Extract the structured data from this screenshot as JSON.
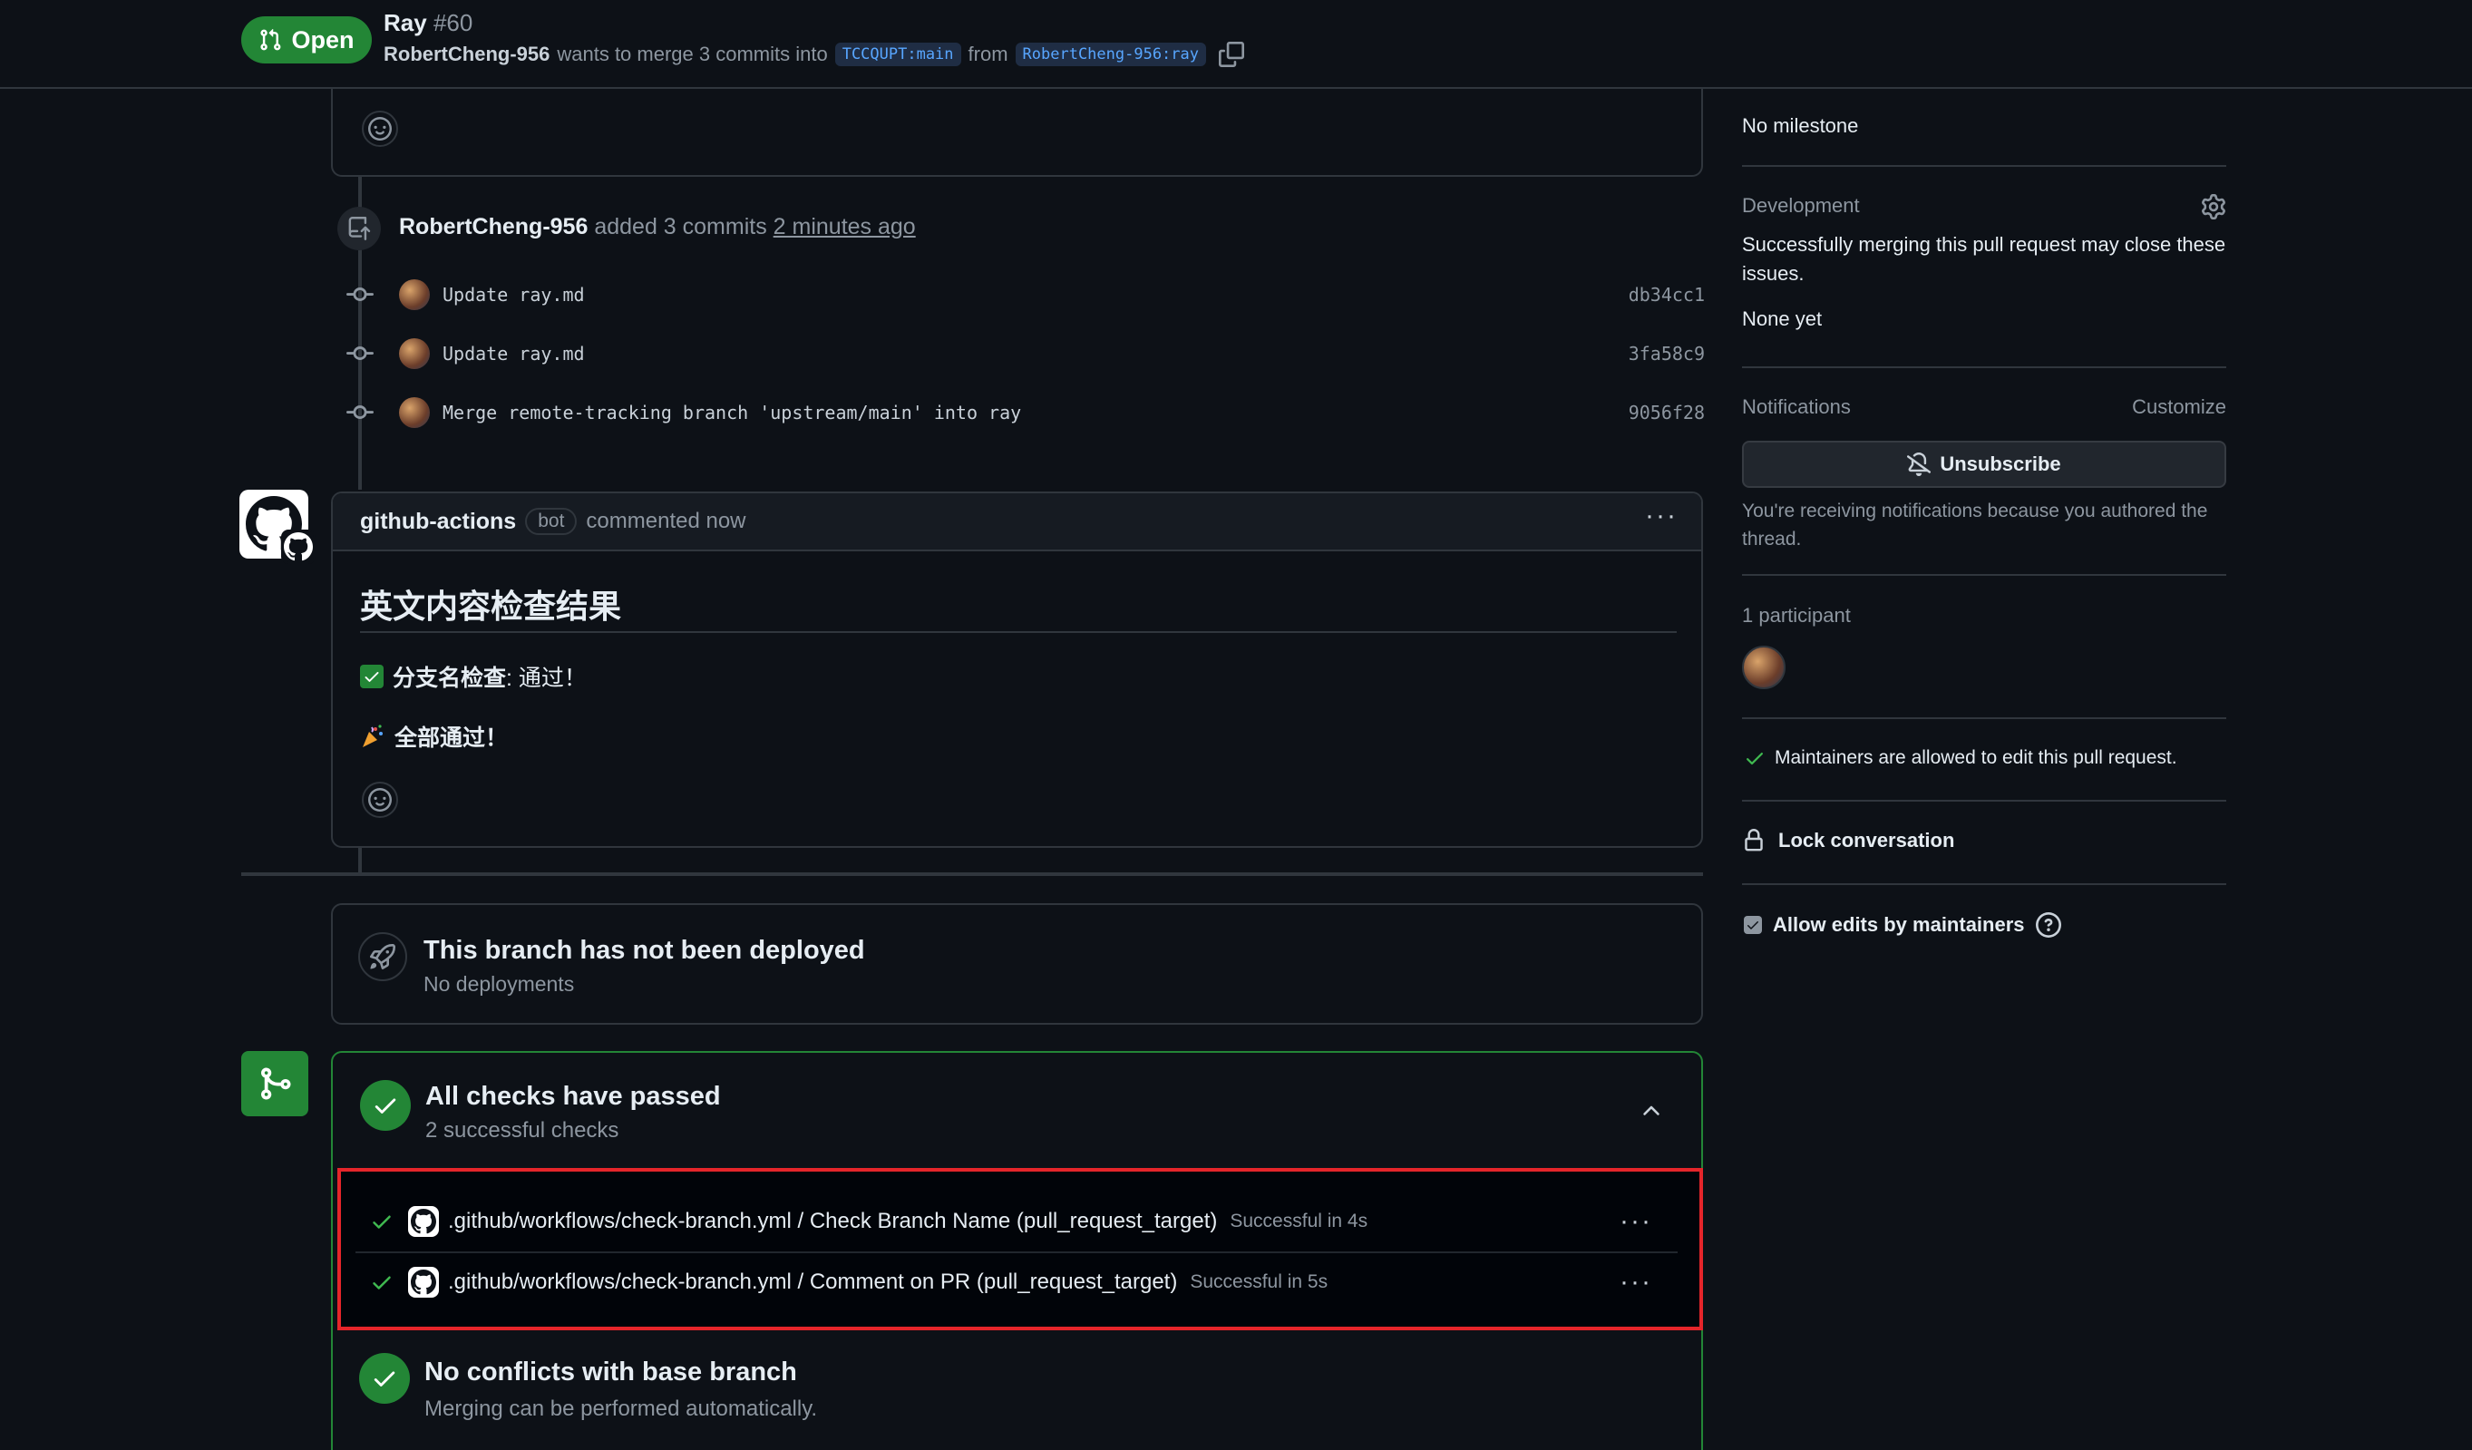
{
  "header": {
    "state": "Open",
    "title": "Ray",
    "number": "#60",
    "author": "RobertCheng-956",
    "merge_text": "wants to merge 3 commits into",
    "base_branch": "TCCQUPT:main",
    "from_text": "from",
    "head_branch": "RobertCheng-956:ray"
  },
  "timeline": {
    "commits_event": {
      "author": "RobertCheng-956",
      "action": "added 3 commits",
      "time": "2 minutes ago",
      "commits": [
        {
          "message": "Update ray.md",
          "sha": "db34cc1"
        },
        {
          "message": "Update ray.md",
          "sha": "3fa58c9"
        },
        {
          "message": "Merge remote-tracking branch 'upstream/main' into ray",
          "sha": "9056f28"
        }
      ]
    },
    "comment": {
      "author": "github-actions",
      "badge": "bot",
      "time": "commented now",
      "heading": "英文内容检查结果",
      "line1_bold": "分支名检查",
      "line1_rest": ": 通过！",
      "line2_bold": "全部通过！"
    },
    "deploy": {
      "title": "This branch has not been deployed",
      "subtitle": "No deployments"
    },
    "checks": {
      "title": "All checks have passed",
      "subtitle": "2 successful checks",
      "items": [
        {
          "name": ".github/workflows/check-branch.yml / Check Branch Name (pull_request_target)",
          "status": "Successful in 4s"
        },
        {
          "name": ".github/workflows/check-branch.yml / Comment on PR (pull_request_target)",
          "status": "Successful in 5s"
        }
      ]
    },
    "conflicts": {
      "title": "No conflicts with base branch",
      "subtitle": "Merging can be performed automatically."
    }
  },
  "sidebar": {
    "milestone_value": "No milestone",
    "development_label": "Development",
    "development_text": "Successfully merging this pull request may close these issues.",
    "development_none": "None yet",
    "notifications_label": "Notifications",
    "customize": "Customize",
    "unsubscribe": "Unsubscribe",
    "notif_reason": "You're receiving notifications because you authored the thread.",
    "participants_label": "1 participant",
    "maintainers_text": "Maintainers are allowed to edit this pull request.",
    "lock_label": "Lock conversation",
    "allow_edits_label": "Allow edits by maintainers"
  },
  "colors": {
    "green": "#238636",
    "highlight_border": "#e5252a",
    "bg": "#0d1117",
    "border": "#30363d"
  }
}
